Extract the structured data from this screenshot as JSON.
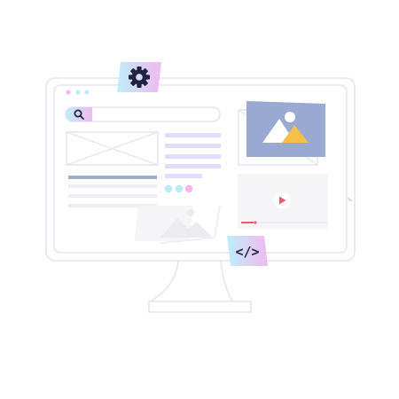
{
  "colors": {
    "outline": "#e6e3f4",
    "outline_dark": "#d8d4ec",
    "lavender": "#e3dcfb",
    "blue_grey": "#9eaed0",
    "light_grey": "#eeeef2",
    "pink_dot": "#f3b7ec",
    "cyan_dot": "#b9eef7",
    "accent_red": "#ef5b6b",
    "gradient_start": "#bdeffa",
    "gradient_end": "#f1b9f0",
    "mountain_white": "#ffffff",
    "mountain_gold": "#f4c04a",
    "photo_bg": "#99a9d1",
    "icon_dark": "#1f2240"
  },
  "icons": {
    "settings": "gear-icon",
    "search": "search-icon",
    "code": "code-icon",
    "play": "play-icon",
    "image": "image-icon"
  },
  "code_badge": {
    "text": "</>"
  }
}
